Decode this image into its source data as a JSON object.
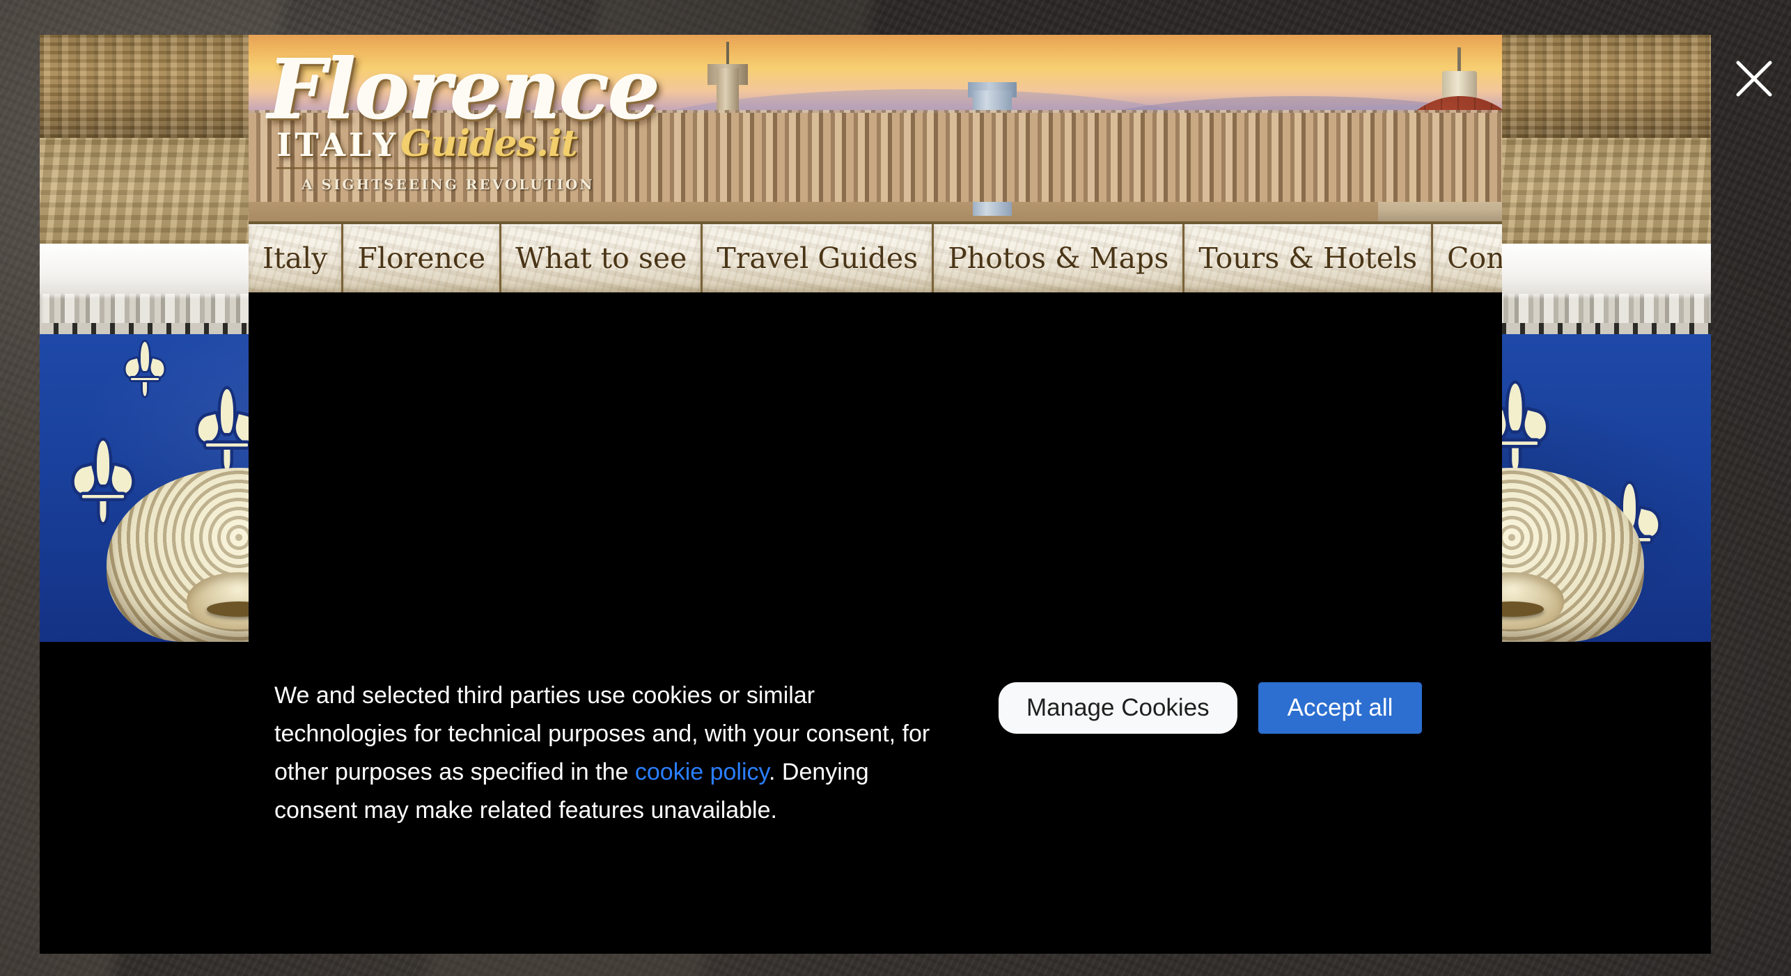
{
  "site": {
    "logo": {
      "title": "Florence",
      "brand_primary": "ITALY",
      "brand_secondary": "Guides.it",
      "tagline": "A SIGHTSEEING REVOLUTION"
    },
    "nav": {
      "items": [
        {
          "label": "Italy"
        },
        {
          "label": "Florence"
        },
        {
          "label": "What to see"
        },
        {
          "label": "Travel Guides"
        },
        {
          "label": "Photos & Maps"
        },
        {
          "label": "Tours & Hotels"
        },
        {
          "label": "Contact us"
        }
      ]
    }
  },
  "cookie_banner": {
    "text_part1": "We and selected third parties use cookies or similar technologies for technical purposes and, with your consent, for other purposes as specified in the ",
    "link_label": "cookie policy",
    "text_part2": ". Denying consent may make related features unavailable.",
    "manage_label": "Manage Cookies",
    "accept_label": "Accept all",
    "link_color": "#2b7fff",
    "accept_color": "#2c6fd1",
    "manage_color": "#f8f9fa"
  },
  "overlay": {
    "close_icon": "close-icon"
  }
}
